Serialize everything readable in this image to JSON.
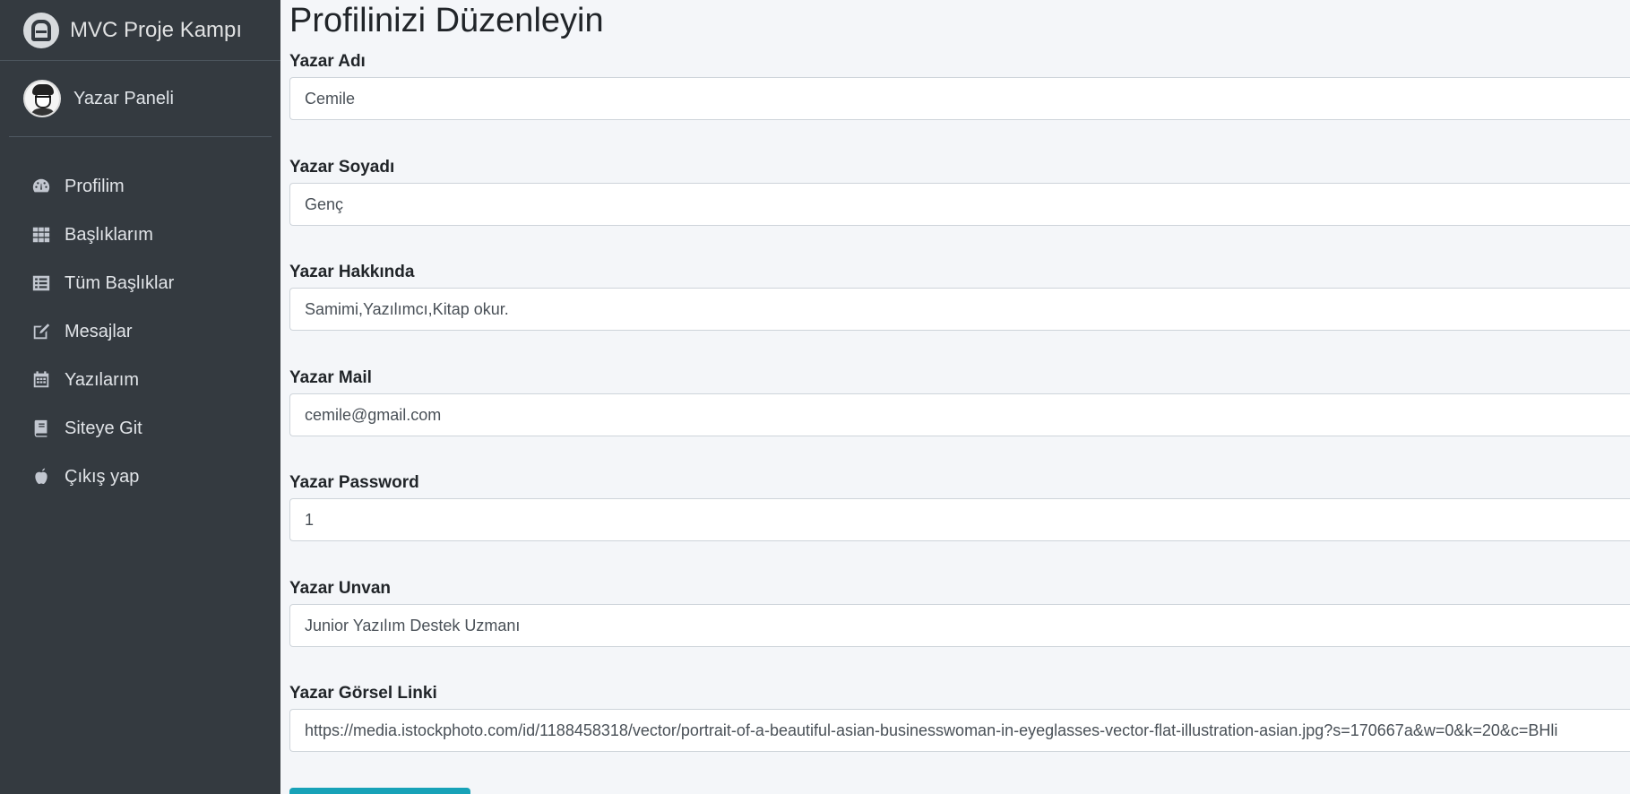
{
  "brand": {
    "title": "MVC Proje Kampı"
  },
  "user": {
    "name": "Yazar Paneli"
  },
  "nav": [
    {
      "label": "Profilim",
      "icon": "tachometer-icon"
    },
    {
      "label": "Başlıklarım",
      "icon": "grid-icon"
    },
    {
      "label": "Tüm Başlıklar",
      "icon": "list-icon"
    },
    {
      "label": "Mesajlar",
      "icon": "edit-icon"
    },
    {
      "label": "Yazılarım",
      "icon": "calendar-icon"
    },
    {
      "label": "Siteye Git",
      "icon": "book-icon"
    },
    {
      "label": "Çıkış yap",
      "icon": "apple-icon"
    }
  ],
  "page": {
    "title": "Profilinizi Düzenleyin"
  },
  "form": {
    "name": {
      "label": "Yazar Adı",
      "value": "Cemile"
    },
    "surname": {
      "label": "Yazar Soyadı",
      "value": "Genç"
    },
    "about": {
      "label": "Yazar Hakkında",
      "value": "Samimi,Yazılımcı,Kitap okur."
    },
    "mail": {
      "label": "Yazar Mail",
      "value": "cemile@gmail.com"
    },
    "password": {
      "label": "Yazar Password",
      "value": "1"
    },
    "title": {
      "label": "Yazar Unvan",
      "value": "Junior Yazılım Destek Uzmanı"
    },
    "image": {
      "label": "Yazar Görsel Linki",
      "value": "https://media.istockphoto.com/id/1188458318/vector/portrait-of-a-beautiful-asian-businesswoman-in-eyeglasses-vector-flat-illustration-asian.jpg?s=170667a&w=0&k=20&c=BHli"
    }
  },
  "colors": {
    "sidebar": "#343a40",
    "background": "#f4f6f9",
    "button": "#17a2b8"
  }
}
